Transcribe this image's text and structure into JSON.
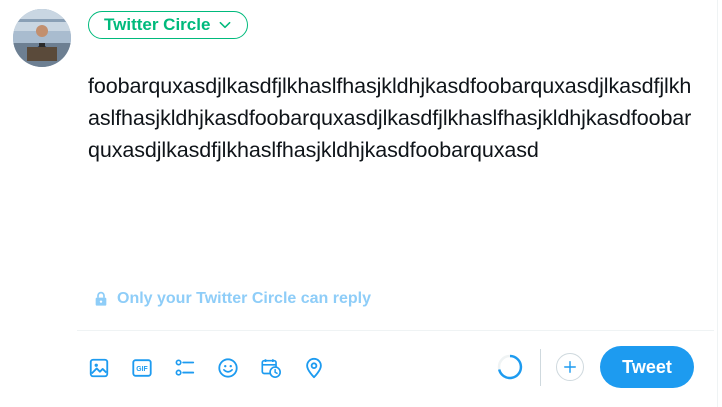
{
  "audience": {
    "label": "Twitter Circle",
    "icon": "chevron-down-icon"
  },
  "composer": {
    "text": "foobarquxasdjlkasdfjlkhaslfhasjkldhjkasdfoobarquxasdjlkasdfjlkhaslfhasjkldhjkasdfoobarquxasdjlkasdfjlkhaslfhasjkldhjkasdfoobarquxasdjlkasdfjlkhaslfhasjkldhjkasdfoobarquxasd"
  },
  "reply_setting": {
    "label": "Only your Twitter Circle can reply",
    "icon": "lock-icon"
  },
  "toolbar": {
    "icons": [
      "image-icon",
      "gif-icon",
      "poll-icon",
      "emoji-icon",
      "schedule-icon",
      "location-icon"
    ],
    "gif_label": "GIF"
  },
  "actions": {
    "tweet_label": "Tweet",
    "add_icon": "plus-icon"
  },
  "colors": {
    "accent": "#1d9bf0",
    "circle_green": "#00ba7c",
    "reply_muted": "#8ecdf8",
    "text": "#0f1419"
  }
}
